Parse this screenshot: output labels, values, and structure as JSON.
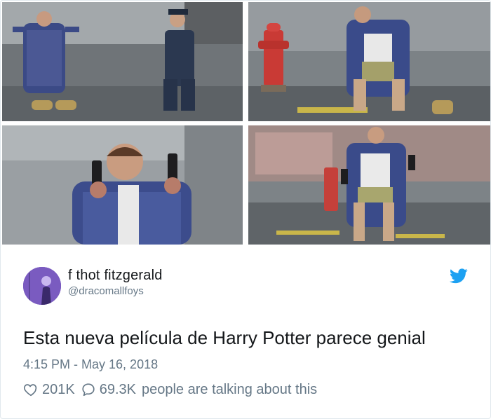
{
  "tweet": {
    "display_name": "f thot fitzgerald",
    "handle": "@dracomallfoys",
    "text": "Esta nueva película de Harry Potter parece genial",
    "timestamp": "4:15 PM - May 16, 2018",
    "likes": "201K",
    "replies": "69.3K",
    "talking_text": "people are talking about this",
    "brand_color": "#1da1f2"
  },
  "icons": {
    "bird": "twitter-bird-icon",
    "like": "heart-icon",
    "reply": "speech-bubble-icon"
  }
}
